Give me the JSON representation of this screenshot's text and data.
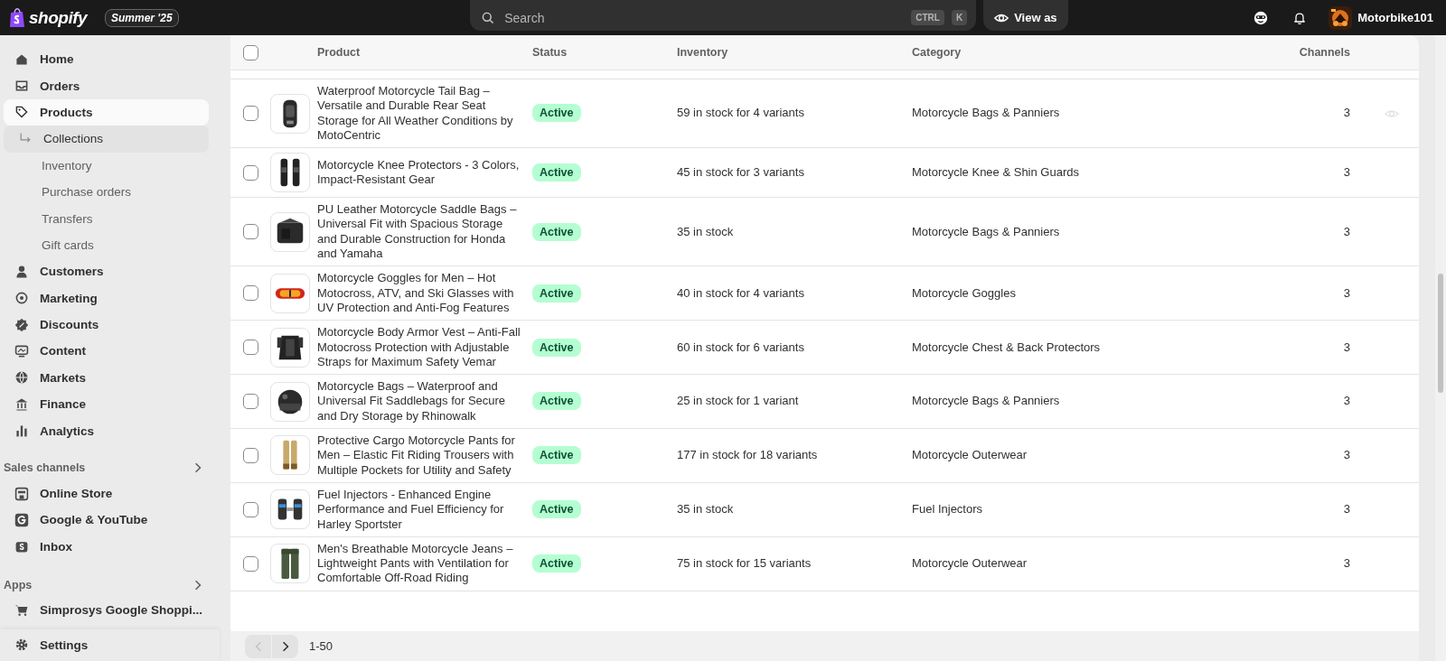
{
  "topbar": {
    "logo": "shopify",
    "edition_badge": "Summer '25",
    "search": {
      "placeholder": "Search",
      "shortcut_keys": [
        "CTRL",
        "K"
      ]
    },
    "view_as_button": "View as",
    "store_name": "Motorbike101"
  },
  "sidebar": {
    "items": [
      {
        "label": "Home",
        "selected": false
      },
      {
        "label": "Orders",
        "selected": false
      },
      {
        "label": "Products",
        "selected": true,
        "children": [
          {
            "label": "Collections",
            "selected": true
          },
          {
            "label": "Inventory",
            "selected": false
          },
          {
            "label": "Purchase orders",
            "selected": false
          },
          {
            "label": "Transfers",
            "selected": false
          },
          {
            "label": "Gift cards",
            "selected": false
          }
        ]
      },
      {
        "label": "Customers",
        "selected": false
      },
      {
        "label": "Marketing",
        "selected": false
      },
      {
        "label": "Discounts",
        "selected": false
      },
      {
        "label": "Content",
        "selected": false
      },
      {
        "label": "Markets",
        "selected": false
      },
      {
        "label": "Finance",
        "selected": false
      },
      {
        "label": "Analytics",
        "selected": false
      }
    ],
    "sales_channels": {
      "title": "Sales channels",
      "items": [
        {
          "label": "Online Store"
        },
        {
          "label": "Google & YouTube"
        },
        {
          "label": "Inbox"
        }
      ]
    },
    "apps": {
      "title": "Apps",
      "items": [
        {
          "label": "Simprosys Google Shoppi..."
        }
      ]
    },
    "settings": "Settings"
  },
  "table": {
    "select_all_checked": false,
    "columns": [
      "Product",
      "Status",
      "Inventory",
      "Category",
      "Channels"
    ],
    "rows": [
      {
        "product": "Waterproof Motorcycle Tail Bag – Versatile and Durable Rear Seat Storage for All Weather Conditions by MotoCentric",
        "status": "Active",
        "inventory": "59 in stock for 4 variants",
        "category": "Motorcycle Bags & Panniers",
        "channels": "3",
        "checked": false,
        "preview_shown": true
      },
      {
        "product": "Motorcycle Knee Protectors - 3 Colors, Impact-Resistant Gear",
        "status": "Active",
        "inventory": "45 in stock for 3 variants",
        "category": "Motorcycle Knee & Shin Guards",
        "channels": "3",
        "checked": false,
        "preview_shown": false
      },
      {
        "product": "PU Leather Motorcycle Saddle Bags – Universal Fit with Spacious Storage and Durable Construction for Honda and Yamaha",
        "status": "Active",
        "inventory": "35 in stock",
        "category": "Motorcycle Bags & Panniers",
        "channels": "3",
        "checked": false,
        "preview_shown": false
      },
      {
        "product": "Motorcycle Goggles for Men – Hot Motocross, ATV, and Ski Glasses with UV Protection and Anti-Fog Features",
        "status": "Active",
        "inventory": "40 in stock for 4 variants",
        "category": "Motorcycle Goggles",
        "channels": "3",
        "checked": false,
        "preview_shown": false
      },
      {
        "product": "Motorcycle Body Armor Vest – Anti-Fall Motocross Protection with Adjustable Straps for Maximum Safety Vemar",
        "status": "Active",
        "inventory": "60 in stock for 6 variants",
        "category": "Motorcycle Chest & Back Protectors",
        "channels": "3",
        "checked": false,
        "preview_shown": false
      },
      {
        "product": "Motorcycle Bags – Waterproof and Universal Fit Saddlebags for Secure and Dry Storage by Rhinowalk",
        "status": "Active",
        "inventory": "25 in stock for 1 variant",
        "category": "Motorcycle Bags & Panniers",
        "channels": "3",
        "checked": false,
        "preview_shown": false
      },
      {
        "product": "Protective Cargo Motorcycle Pants for Men – Elastic Fit Riding Trousers with Multiple Pockets for Utility and Safety",
        "status": "Active",
        "inventory": "177 in stock for 18 variants",
        "category": "Motorcycle Outerwear",
        "channels": "3",
        "checked": false,
        "preview_shown": false
      },
      {
        "product": "Fuel Injectors - Enhanced Engine Performance and Fuel Efficiency for Harley Sportster",
        "status": "Active",
        "inventory": "35 in stock",
        "category": "Fuel Injectors",
        "channels": "3",
        "checked": false,
        "preview_shown": false
      },
      {
        "product": "Men's Breathable Motorcycle Jeans – Lightweight Pants with Ventilation for Comfortable Off-Road Riding",
        "status": "Active",
        "inventory": "75 in stock for 15 variants",
        "category": "Motorcycle Outerwear",
        "channels": "3",
        "checked": false,
        "preview_shown": false
      }
    ]
  },
  "pagination": {
    "range": "1-50",
    "previous_disabled": true
  }
}
